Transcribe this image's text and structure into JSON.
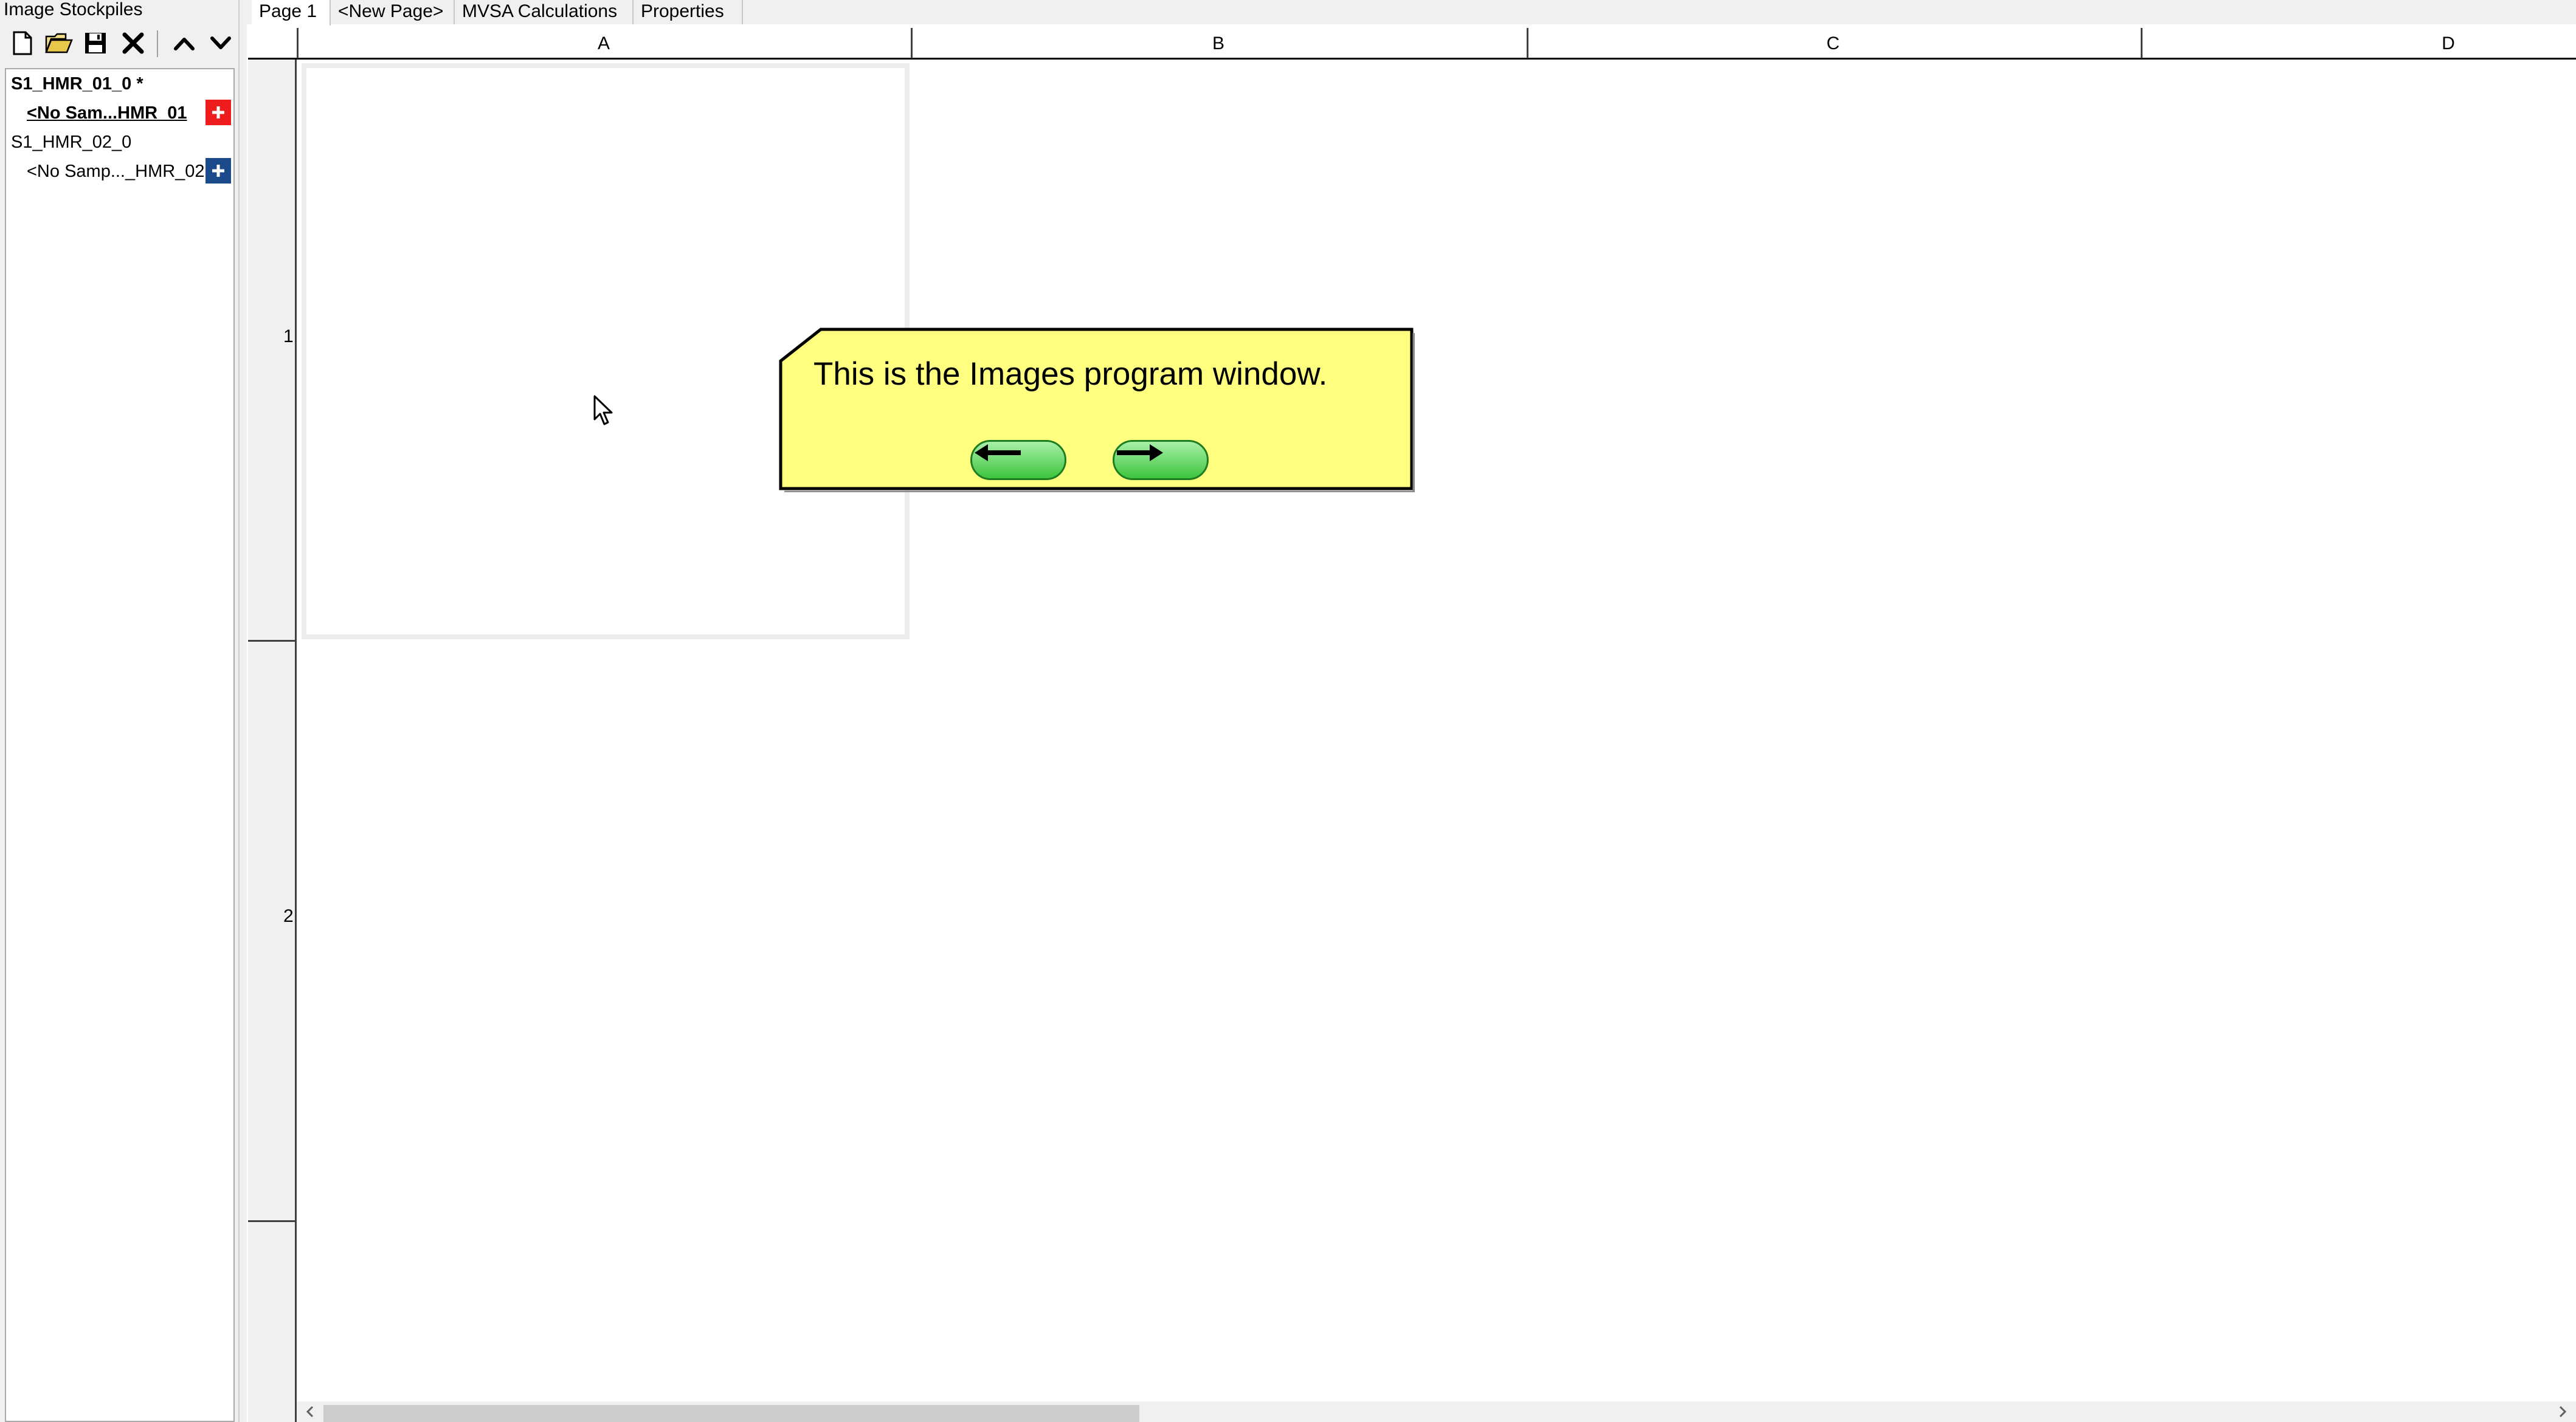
{
  "left_panel": {
    "title": "Image Stockpiles",
    "toolbar": [
      "new-icon",
      "open-icon",
      "save-icon",
      "close-icon",
      "move-up-icon",
      "move-down-icon"
    ],
    "tree": [
      {
        "label": "S1_HMR_01_0 *",
        "bold": true
      },
      {
        "label": "<No Sam...HMR_01",
        "bold": true,
        "underline": true,
        "add_button": "+",
        "add_color": "#ee1c1c"
      },
      {
        "label": "S1_HMR_02_0"
      },
      {
        "label": "<No Samp..._HMR_02",
        "add_button": "+",
        "add_color": "#1c4b8c"
      }
    ]
  },
  "tabs": [
    {
      "label": "Page 1",
      "active": true
    },
    {
      "label": "<New Page>"
    },
    {
      "label": "MVSA Calculations"
    },
    {
      "label": "Properties"
    }
  ],
  "grid": {
    "columns": [
      "A",
      "B",
      "C",
      "D"
    ],
    "rows": [
      "1",
      "2"
    ]
  },
  "callout": {
    "text": "This is the Images program window.",
    "back_icon": "arrow-left-icon",
    "next_icon": "arrow-right-icon",
    "background": "#ffff80"
  },
  "colors": {
    "panel_bg": "#f0f0f0",
    "button_green": "#3cc43c"
  }
}
